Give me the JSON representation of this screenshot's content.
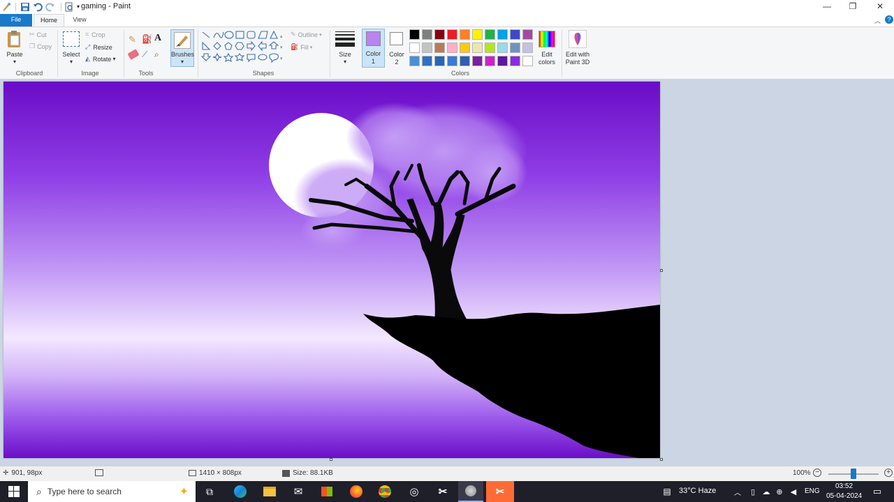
{
  "window": {
    "title": "gaming - Paint",
    "minimize_glyph": "—",
    "restore_glyph": "❐",
    "close_glyph": "✕"
  },
  "tabs": [
    {
      "label": "File"
    },
    {
      "label": "Home"
    },
    {
      "label": "View"
    }
  ],
  "ribbon": {
    "clipboard": {
      "paste": "Paste",
      "cut": "Cut",
      "copy": "Copy",
      "group": "Clipboard"
    },
    "image": {
      "select": "Select",
      "crop": "Crop",
      "resize": "Resize",
      "rotate": "Rotate",
      "group": "Image"
    },
    "tools": {
      "group": "Tools"
    },
    "brushes": {
      "label": "Brushes"
    },
    "shapes": {
      "outline": "Outline",
      "fill": "Fill",
      "group": "Shapes"
    },
    "size": {
      "label": "Size"
    },
    "color1": {
      "line1": "Color",
      "line2": "1"
    },
    "color2": {
      "line1": "Color",
      "line2": "2"
    },
    "colors": {
      "group": "Colors"
    },
    "edit_colors": {
      "line1": "Edit",
      "line2": "colors"
    },
    "paint3d": {
      "line1": "Edit with",
      "line2": "Paint 3D"
    },
    "palette": [
      "#000000",
      "#7f7f7f",
      "#880015",
      "#ed1c24",
      "#ff7f27",
      "#fff200",
      "#22b14c",
      "#00a2e8",
      "#3f48cc",
      "#a349a4",
      "#ffffff",
      "#c3c3c3",
      "#b97a57",
      "#ffaec9",
      "#ffc90e",
      "#efe4b0",
      "#b5e61d",
      "#99d9ea",
      "#7092be",
      "#c8bfe7",
      "#4a90d9",
      "#2f6fc4",
      "#2b65b5",
      "#3a7bd5",
      "#2e5fb0",
      "#7a1fa2",
      "#cc22cc",
      "#5b1aa0",
      "#8a2be2",
      "#ffffff"
    ],
    "color1_value": "#b784f0",
    "color2_value": "#ffffff"
  },
  "status": {
    "cursor_pos": "901, 98px",
    "dimensions": "1410 × 808px",
    "size": "Size: 88.1KB",
    "zoom": "100%"
  },
  "taskbar": {
    "search_placeholder": "Type here to search",
    "weather": "33°C  Haze",
    "lang": "ENG",
    "time": "03:52",
    "date": "05-04-2024"
  }
}
